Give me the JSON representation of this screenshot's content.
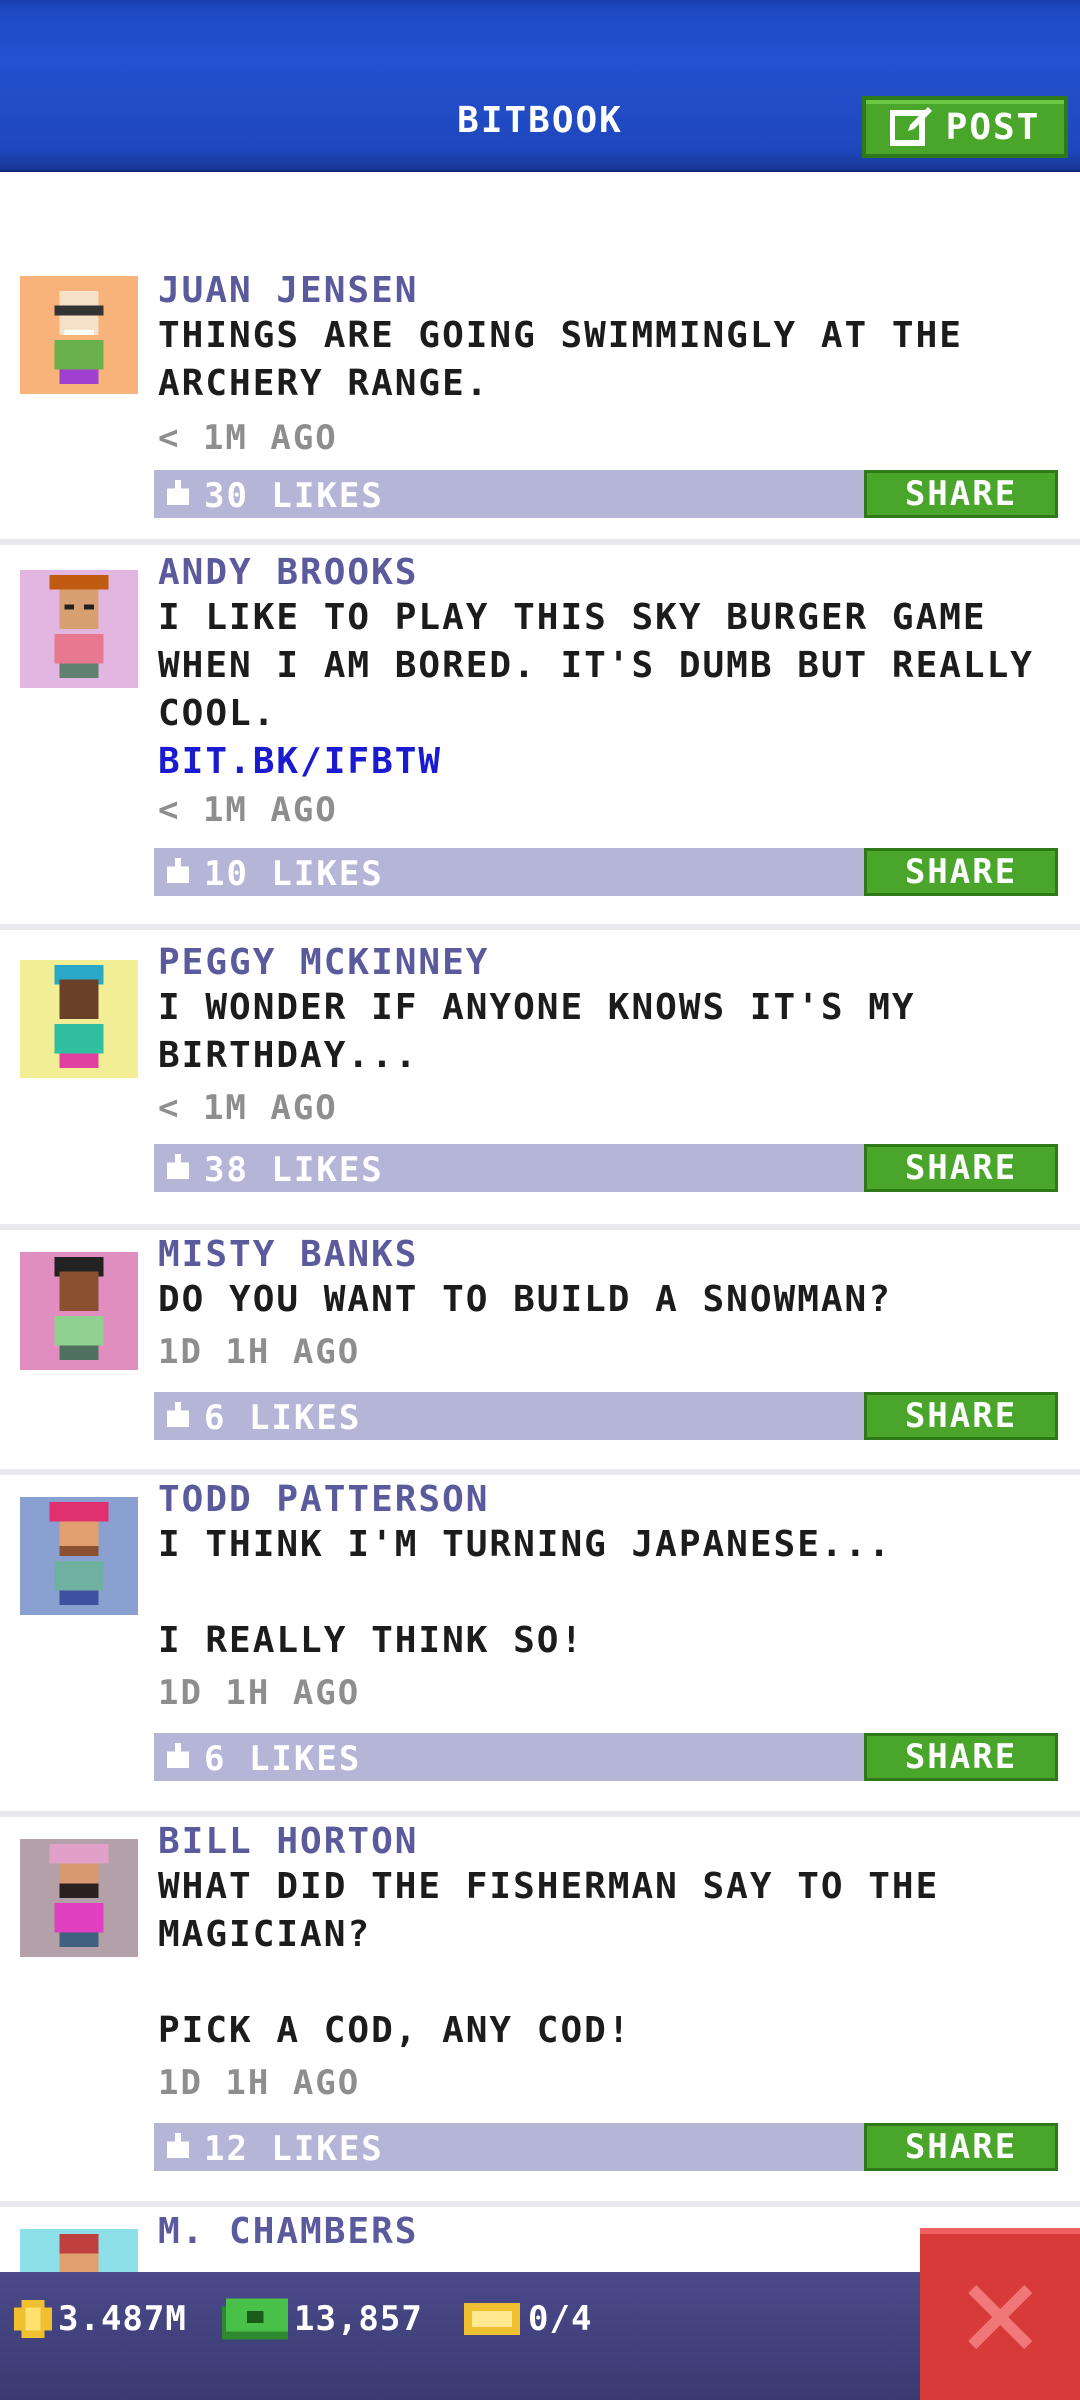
{
  "header": {
    "title": "BITBOOK",
    "post_label": "POST"
  },
  "posts": [
    {
      "name": "JUAN JENSEN",
      "text": "THINGS ARE GOING SWIMMINGLY AT THE\nARCHERY RANGE.",
      "link": "",
      "time": "< 1M AGO",
      "likes": "30 LIKES",
      "share": "SHARE",
      "avatar_bg": "#f7b37a"
    },
    {
      "name": "ANDY BROOKS",
      "text": "I LIKE TO PLAY THIS SKY BURGER GAME\nWHEN I AM BORED. IT'S DUMB BUT REALLY\nCOOL.",
      "link": "BIT.BK/IFBTW",
      "time": "< 1M AGO",
      "likes": "10 LIKES",
      "share": "SHARE",
      "avatar_bg": "#e2b6e0"
    },
    {
      "name": "PEGGY MCKINNEY",
      "text": "I WONDER IF ANYONE KNOWS IT'S MY\nBIRTHDAY...",
      "link": "",
      "time": "< 1M AGO",
      "likes": "38 LIKES",
      "share": "SHARE",
      "avatar_bg": "#f2ee96"
    },
    {
      "name": "MISTY BANKS",
      "text": "DO YOU WANT TO BUILD A SNOWMAN?",
      "link": "",
      "time": "1D 1H AGO",
      "likes": "6 LIKES",
      "share": "SHARE",
      "avatar_bg": "#e08ec0"
    },
    {
      "name": "TODD PATTERSON",
      "text": "I THINK I'M TURNING JAPANESE...\n\nI REALLY THINK SO!",
      "link": "",
      "time": "1D 1H AGO",
      "likes": "6 LIKES",
      "share": "SHARE",
      "avatar_bg": "#8aa0d0"
    },
    {
      "name": "BILL HORTON",
      "text": "WHAT DID THE FISHERMAN SAY TO THE\nMAGICIAN?\n\nPICK A COD, ANY COD!",
      "link": "",
      "time": "1D 1H AGO",
      "likes": "12 LIKES",
      "share": "SHARE",
      "avatar_bg": "#b4a0a8"
    },
    {
      "name": "M. CHAMBERS",
      "text": "",
      "link": "",
      "time": "",
      "likes": "",
      "share": "",
      "avatar_bg": "#8de0e8"
    }
  ],
  "footer": {
    "coins": "3.487M",
    "bux": "13,857",
    "tickets": "0/4"
  },
  "colors": {
    "header_blue": "#2352d0",
    "accent_green": "#49a62a",
    "likes_bar": "#b5b5d8",
    "close_red": "#d83a3a"
  }
}
